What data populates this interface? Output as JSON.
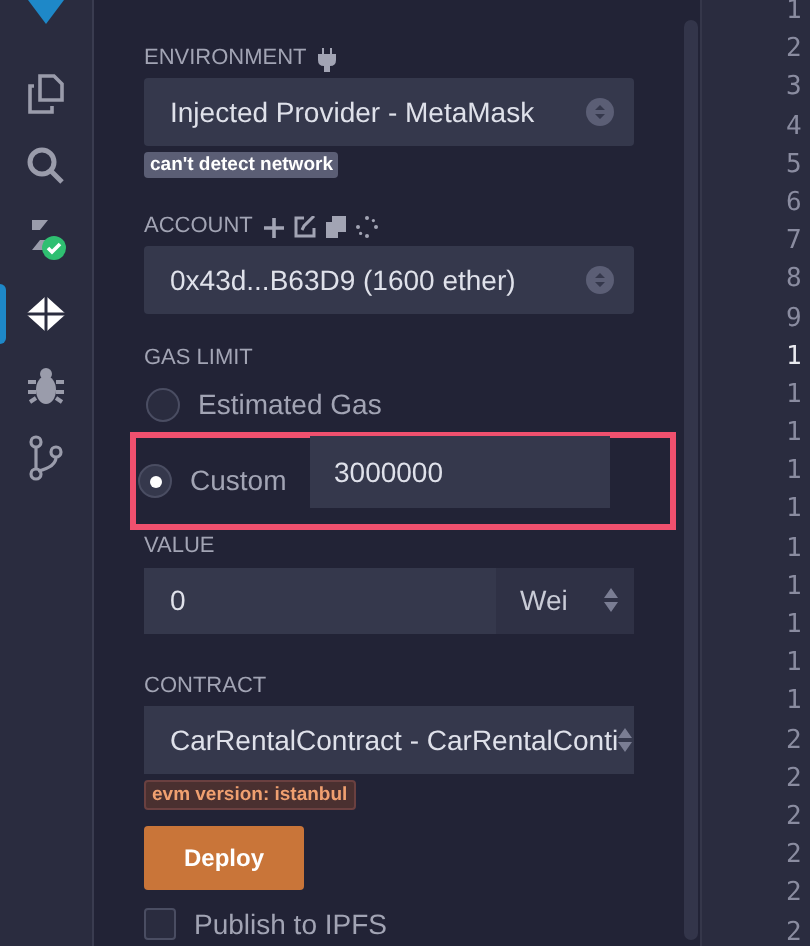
{
  "sidebar": {
    "items": [
      {
        "selected": false
      },
      {
        "selected": false
      },
      {
        "selected": false
      },
      {
        "selected": true
      },
      {
        "selected": false
      },
      {
        "selected": false
      }
    ]
  },
  "environment": {
    "label": "ENVIRONMENT",
    "value": "Injected Provider - MetaMask",
    "badge": "can't detect network"
  },
  "account": {
    "label": "ACCOUNT",
    "value": "0x43d...B63D9 (1600 ether)"
  },
  "gas_limit": {
    "label": "GAS LIMIT",
    "options": [
      {
        "label": "Estimated Gas",
        "selected": false
      },
      {
        "label": "Custom",
        "selected": true
      }
    ],
    "custom_value": "3000000",
    "highlighted": true
  },
  "value": {
    "label": "VALUE",
    "amount": "0",
    "unit": "Wei"
  },
  "contract": {
    "label": "CONTRACT",
    "value": "CarRentalContract - CarRentalConti",
    "badge": "evm version: istanbul"
  },
  "deploy_button": "Deploy",
  "publish": {
    "label": "Publish to IPFS",
    "checked": false
  },
  "line_numbers": [
    {
      "text": "1",
      "current": false
    },
    {
      "text": "2",
      "current": false
    },
    {
      "text": "3",
      "current": false
    },
    {
      "text": "4",
      "current": false
    },
    {
      "text": "5",
      "current": false
    },
    {
      "text": "6",
      "current": false
    },
    {
      "text": "7",
      "current": false
    },
    {
      "text": "8",
      "current": false
    },
    {
      "text": "9",
      "current": false
    },
    {
      "text": "1",
      "current": true
    },
    {
      "text": "1",
      "current": false
    },
    {
      "text": "1",
      "current": false
    },
    {
      "text": "1",
      "current": false
    },
    {
      "text": "1",
      "current": false
    },
    {
      "text": "1",
      "current": false
    },
    {
      "text": "1",
      "current": false
    },
    {
      "text": "1",
      "current": false
    },
    {
      "text": "1",
      "current": false
    },
    {
      "text": "1",
      "current": false
    },
    {
      "text": "2",
      "current": false
    },
    {
      "text": "2",
      "current": false
    },
    {
      "text": "2",
      "current": false
    },
    {
      "text": "2",
      "current": false
    },
    {
      "text": "2",
      "current": false
    },
    {
      "text": "2",
      "current": false
    }
  ]
}
